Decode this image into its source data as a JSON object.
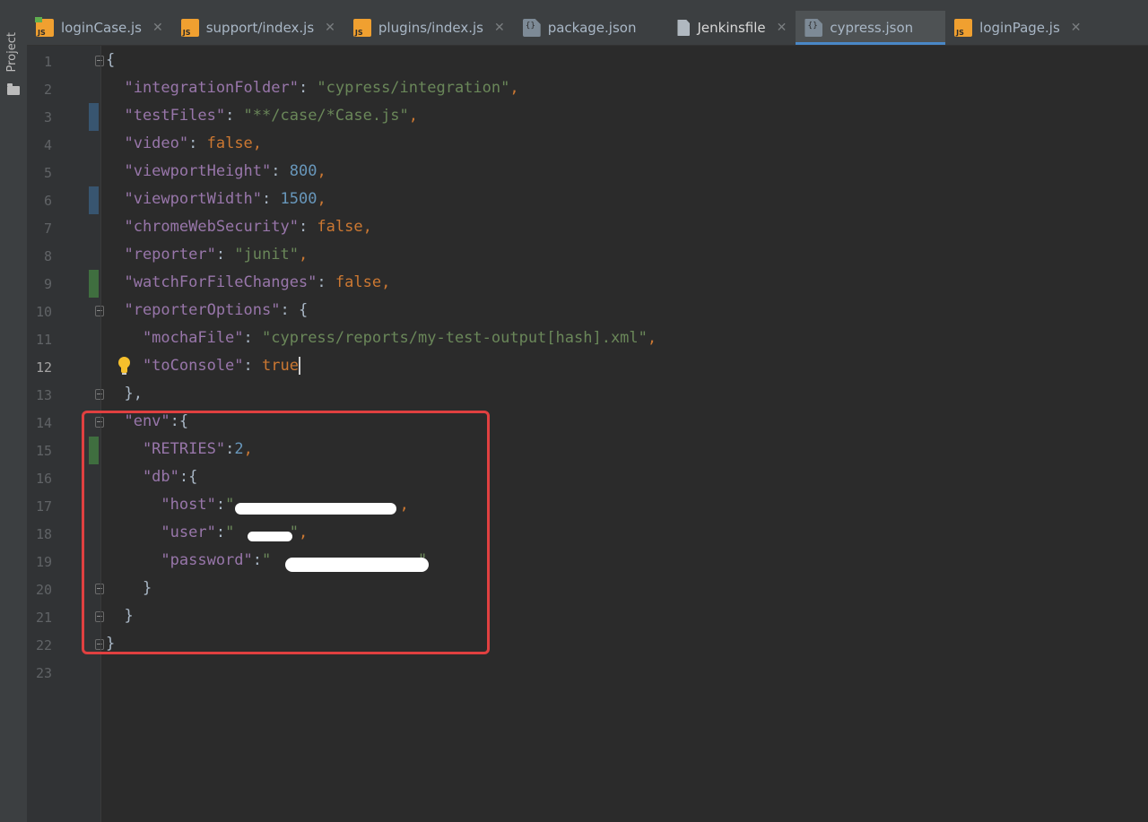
{
  "sidebar": {
    "label": "Project",
    "icon": "folder-icon"
  },
  "tabs": [
    {
      "label": "loginCase.js",
      "icon": "js-file-icon",
      "active": false,
      "close": "✕"
    },
    {
      "label": "support/index.js",
      "icon": "js-file-icon",
      "active": false,
      "close": "✕"
    },
    {
      "label": "plugins/index.js",
      "icon": "js-file-icon",
      "active": false,
      "close": "✕"
    },
    {
      "label": "package.json",
      "icon": "json-file-icon",
      "active": false,
      "close": ""
    },
    {
      "label": "Jenkinsfile",
      "icon": "text-file-icon",
      "active": false,
      "close": "✕"
    },
    {
      "label": "cypress.json",
      "icon": "json-file-icon",
      "active": true,
      "close": ""
    },
    {
      "label": "loginPage.js",
      "icon": "js-file-icon",
      "active": false,
      "close": "✕"
    }
  ],
  "editor": {
    "current_line": 12,
    "lines": [
      {
        "n": "1",
        "tokens": [
          [
            "p",
            "{"
          ]
        ]
      },
      {
        "n": "2",
        "tokens": [
          [
            "k",
            "  \"integrationFolder\""
          ],
          [
            "p",
            ": "
          ],
          [
            "s",
            "\"cypress/integration\""
          ],
          [
            "b",
            ","
          ]
        ]
      },
      {
        "n": "3",
        "tokens": [
          [
            "k",
            "  \"testFiles\""
          ],
          [
            "p",
            ": "
          ],
          [
            "s",
            "\"**/case/*Case.js\""
          ],
          [
            "b",
            ","
          ]
        ]
      },
      {
        "n": "4",
        "tokens": [
          [
            "k",
            "  \"video\""
          ],
          [
            "p",
            ": "
          ],
          [
            "b",
            "false,"
          ]
        ]
      },
      {
        "n": "5",
        "tokens": [
          [
            "k",
            "  \"viewportHeight\""
          ],
          [
            "p",
            ": "
          ],
          [
            "n",
            "800"
          ],
          [
            "b",
            ","
          ]
        ]
      },
      {
        "n": "6",
        "tokens": [
          [
            "k",
            "  \"viewportWidth\""
          ],
          [
            "p",
            ": "
          ],
          [
            "n",
            "1500"
          ],
          [
            "b",
            ","
          ]
        ]
      },
      {
        "n": "7",
        "tokens": [
          [
            "k",
            "  \"chromeWebSecurity\""
          ],
          [
            "p",
            ": "
          ],
          [
            "b",
            "false,"
          ]
        ]
      },
      {
        "n": "8",
        "tokens": [
          [
            "k",
            "  \"reporter\""
          ],
          [
            "p",
            ": "
          ],
          [
            "s",
            "\"junit\""
          ],
          [
            "b",
            ","
          ]
        ]
      },
      {
        "n": "9",
        "tokens": [
          [
            "k",
            "  \"watchForFileChanges\""
          ],
          [
            "p",
            ": "
          ],
          [
            "b",
            "false,"
          ]
        ]
      },
      {
        "n": "10",
        "tokens": [
          [
            "k",
            "  \"reporterOptions\""
          ],
          [
            "p",
            ": {"
          ]
        ]
      },
      {
        "n": "11",
        "tokens": [
          [
            "k",
            "    \"mochaFile\""
          ],
          [
            "p",
            ": "
          ],
          [
            "s",
            "\"cypress/reports/my-test-output[hash].xml\""
          ],
          [
            "b",
            ","
          ]
        ]
      },
      {
        "n": "12",
        "tokens": [
          [
            "k",
            "    \"toConsole\""
          ],
          [
            "p",
            ": "
          ],
          [
            "b",
            "true"
          ]
        ]
      },
      {
        "n": "13",
        "tokens": [
          [
            "p",
            "  },"
          ]
        ]
      },
      {
        "n": "14",
        "tokens": [
          [
            "k",
            "  \"env\""
          ],
          [
            "p",
            ":{"
          ]
        ]
      },
      {
        "n": "15",
        "tokens": [
          [
            "k",
            "    \"RETRIES\""
          ],
          [
            "p",
            ":"
          ],
          [
            "n",
            "2"
          ],
          [
            "b",
            ","
          ]
        ]
      },
      {
        "n": "16",
        "tokens": [
          [
            "k",
            "    \"db\""
          ],
          [
            "p",
            ":{"
          ]
        ]
      },
      {
        "n": "17",
        "tokens": [
          [
            "k",
            "      \"host\""
          ],
          [
            "p",
            ":"
          ],
          [
            "s",
            "\""
          ],
          [
            "s",
            "                  "
          ],
          [
            "b",
            ","
          ]
        ]
      },
      {
        "n": "18",
        "tokens": [
          [
            "k",
            "      \"user\""
          ],
          [
            "p",
            ":"
          ],
          [
            "s",
            "\"      \""
          ],
          [
            "b",
            ","
          ]
        ]
      },
      {
        "n": "19",
        "tokens": [
          [
            "k",
            "      \"password\""
          ],
          [
            "p",
            ":"
          ],
          [
            "s",
            "\"                \""
          ]
        ]
      },
      {
        "n": "20",
        "tokens": [
          [
            "p",
            "    }"
          ]
        ]
      },
      {
        "n": "21",
        "tokens": [
          [
            "p",
            "  }"
          ]
        ]
      },
      {
        "n": "22",
        "tokens": [
          [
            "p",
            "}"
          ]
        ]
      },
      {
        "n": "23",
        "tokens": []
      }
    ]
  },
  "colors": {
    "key": "#9876aa",
    "string": "#6a8759",
    "number": "#6897bb",
    "keyword": "#cc7832",
    "highlight_border": "#e04040",
    "active_tab_underline": "#4a88c7"
  }
}
